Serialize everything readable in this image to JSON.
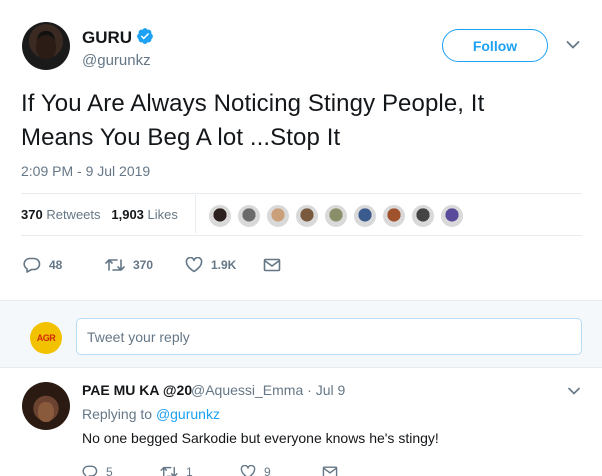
{
  "tweet": {
    "author_name": "GURU",
    "author_handle": "@gurunkz",
    "follow_label": "Follow",
    "text_line1": "If You Are Always Noticing Stingy People, It",
    "text_line2": "Means You Beg A lot ...Stop It",
    "timestamp": "2:09 PM - 9 Jul 2019",
    "retweet_count": "370",
    "retweet_label": "Retweets",
    "like_count": "1,903",
    "like_label": "Likes",
    "actions": {
      "reply_count": "48",
      "retweet_count": "370",
      "like_count": "1.9K"
    },
    "liker_colors": [
      "#2b2220",
      "#6b6b6b",
      "#c9a07a",
      "#7a5a3e",
      "#8a8f6a",
      "#3b5b8f",
      "#a0522d",
      "#444444",
      "#5a4a9a"
    ]
  },
  "reply_box": {
    "placeholder": "Tweet your reply"
  },
  "reply": {
    "author_name": "PAE MU KA @20",
    "author_handle": "@Aquessi_Emma · Jul 9",
    "replying_to_label": "Replying to",
    "replying_to_handle": "@gurunkz",
    "text": "No one begged Sarkodie but everyone knows he's stingy!",
    "reply_count": "5",
    "retweet_count": "1",
    "like_count": "9"
  },
  "colors": {
    "accent": "#1da1f2",
    "muted": "#657786",
    "divider": "#e6ecf0"
  }
}
